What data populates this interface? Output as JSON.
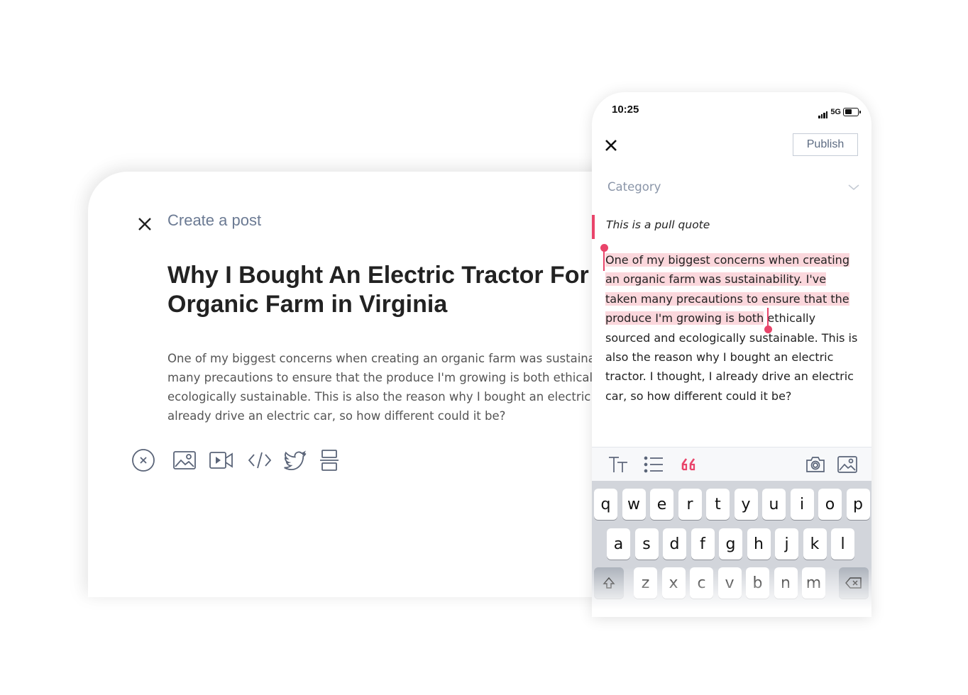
{
  "desktop": {
    "header_title": "Create a post",
    "post_title": "Why I Bought An Electric Tractor For\nOrganic Farm in Virginia",
    "post_body": "One of my biggest concerns when creating an organic farm was sustainability. I've taken\nmany precautions to ensure that the produce I'm growing is both ethically sourced and\necologically sustainable. This is also the reason why I bought an electric tractor. I thought, I\nalready drive an electric car, so how different could it be?",
    "toolbar_icons": [
      "close-circle-icon",
      "image-icon",
      "video-icon",
      "code-icon",
      "twitter-icon",
      "divider-icon"
    ]
  },
  "phone": {
    "status": {
      "time": "10:25",
      "network": "5G"
    },
    "publish_label": "Publish",
    "category_label": "Category",
    "pull_quote": "This is a pull quote",
    "body_lines": {
      "l1": "One of my biggest concerns when creating",
      "l2": "an organic farm was sustainability. I've",
      "l3": "taken many precautions to ensure that the",
      "l4_selected": "produce I'm growing is both",
      "l4_rest": " ethically",
      "l5": "sourced and ecologically sustainable. This is",
      "l6": "also the reason why I bought an electric",
      "l7": "tractor. I thought, I already drive an electric",
      "l8": "car, so how different could it be?"
    },
    "format_icons": [
      "text-size-icon",
      "list-icon",
      "quote-icon",
      "camera-icon",
      "image-icon"
    ],
    "keyboard": {
      "row1": [
        "q",
        "w",
        "e",
        "r",
        "t",
        "y",
        "u",
        "i",
        "o",
        "p"
      ],
      "row2": [
        "a",
        "s",
        "d",
        "f",
        "g",
        "h",
        "j",
        "k",
        "l"
      ],
      "row3": [
        "z",
        "x",
        "c",
        "v",
        "b",
        "n",
        "m"
      ]
    }
  },
  "colors": {
    "accent": "#e9446a",
    "selection": "#fbd7dc",
    "muted": "#6b7a93"
  }
}
